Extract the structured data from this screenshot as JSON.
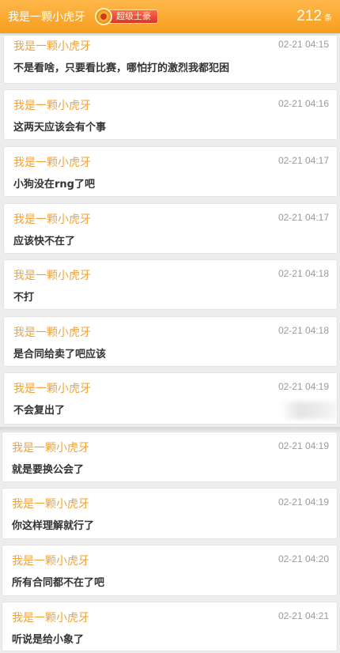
{
  "header": {
    "username": "我是一颗小虎牙",
    "badge_label": "超级土豪",
    "count": "212",
    "count_unit": "条"
  },
  "messages": [
    {
      "name": "我是一颗小虎牙",
      "time": "02-21 04:15",
      "text": "不是看啥，只要看比赛，哪怕打的激烈我都犯困"
    },
    {
      "name": "我是一颗小虎牙",
      "time": "02-21 04:16",
      "text": "这两天应该会有个事"
    },
    {
      "name": "我是一颗小虎牙",
      "time": "02-21 04:17",
      "text": "小狗没在rng了吧"
    },
    {
      "name": "我是一颗小虎牙",
      "time": "02-21 04:17",
      "text": "应该快不在了"
    },
    {
      "name": "我是一颗小虎牙",
      "time": "02-21 04:18",
      "text": "不打"
    },
    {
      "name": "我是一颗小虎牙",
      "time": "02-21 04:18",
      "text": "是合同给卖了吧应该"
    },
    {
      "name": "我是一颗小虎牙",
      "time": "02-21 04:19",
      "text": "不会复出了"
    },
    {
      "name": "我是一颗小虎牙",
      "time": "02-21 04:19",
      "text": "就是要换公会了"
    },
    {
      "name": "我是一颗小虎牙",
      "time": "02-21 04:19",
      "text": "你这样理解就行了"
    },
    {
      "name": "我是一颗小虎牙",
      "time": "02-21 04:20",
      "text": "所有合同都不在了吧"
    },
    {
      "name": "我是一颗小虎牙",
      "time": "02-21 04:21",
      "text": "听说是给小象了"
    }
  ],
  "icons": {
    "badge_medal": "medal-icon"
  },
  "colors": {
    "header_bg": "#f5a623",
    "name_color": "#f0a23a",
    "time_color": "#9a9a9a",
    "message_color": "#333333"
  }
}
